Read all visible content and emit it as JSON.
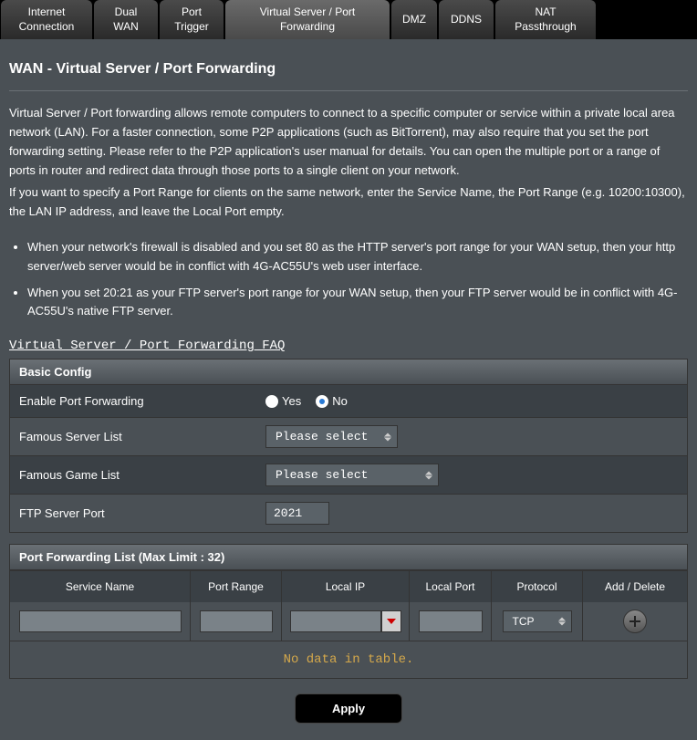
{
  "tabs": [
    {
      "label": "Internet\nConnection"
    },
    {
      "label": "Dual\nWAN"
    },
    {
      "label": "Port\nTrigger"
    },
    {
      "label": "Virtual Server / Port\nForwarding"
    },
    {
      "label": "DMZ"
    },
    {
      "label": "DDNS"
    },
    {
      "label": "NAT\nPassthrough"
    }
  ],
  "title": "WAN - Virtual Server / Port Forwarding",
  "desc1": "Virtual Server / Port forwarding allows remote computers to connect to a specific computer or service within a private local area network (LAN). For a faster connection, some P2P applications (such as BitTorrent), may also require that you set the port forwarding setting. Please refer to the P2P application's user manual for details. You can open the multiple port or a range of ports in router and redirect data through those ports to a single client on your network.",
  "desc2": "If you want to specify a Port Range for clients on the same network, enter the Service Name, the Port Range (e.g. 10200:10300), the LAN IP address, and leave the Local Port empty.",
  "bullet1": "When your network's firewall is disabled and you set 80 as the HTTP server's port range for your WAN setup, then your http server/web server would be in conflict with 4G-AC55U's web user interface.",
  "bullet2": "When you set 20:21 as your FTP server's port range for your WAN setup, then your FTP server would be in conflict with 4G-AC55U's native FTP server.",
  "faq": "Virtual Server / Port Forwarding FAQ",
  "basic": {
    "header": "Basic Config",
    "enable_label": "Enable Port Forwarding",
    "yes": "Yes",
    "no": "No",
    "server_label": "Famous Server List",
    "server_value": "Please select",
    "game_label": "Famous Game List",
    "game_value": "Please select",
    "ftp_label": "FTP Server Port",
    "ftp_value": "2021"
  },
  "list": {
    "header": "Port Forwarding List (Max Limit : 32)",
    "col_service": "Service Name",
    "col_port": "Port Range",
    "col_localip": "Local IP",
    "col_localport": "Local Port",
    "col_protocol": "Protocol",
    "col_action": "Add / Delete",
    "protocol_value": "TCP",
    "no_data": "No data in table."
  },
  "apply": "Apply"
}
